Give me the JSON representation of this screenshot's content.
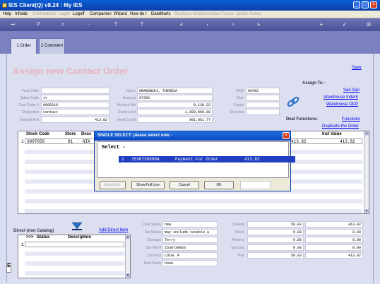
{
  "window": {
    "title": "IES Client(Q) v8.24 : My IES"
  },
  "menu": {
    "items": [
      {
        "label": "Help",
        "enabled": true
      },
      {
        "label": "Infolab",
        "enabled": true
      },
      {
        "label": "Connections",
        "enabled": false
      },
      {
        "label": "Logon",
        "enabled": false
      },
      {
        "label": "Logoff",
        "enabled": true
      },
      {
        "label": "Companion",
        "enabled": true
      },
      {
        "label": "Wizard",
        "enabled": true
      },
      {
        "label": "How do I",
        "enabled": true
      },
      {
        "label": "DataMarts",
        "enabled": true
      },
      {
        "label": "Business Modules",
        "enabled": false
      },
      {
        "label": "Action Focus",
        "enabled": false
      },
      {
        "label": "Option Select",
        "enabled": false
      }
    ]
  },
  "tabs": [
    {
      "label": "1 Order",
      "active": true
    },
    {
      "label": "2 Comment",
      "active": false
    }
  ],
  "page": {
    "title": "Assign new Contact Order",
    "save_link": "Save",
    "assign_to": "Assign To: -",
    "assign_links": [
      "Sari Sari",
      "Warehouse Indent",
      "Warehouse ODP"
    ],
    "deal_functions": "Deal Functions:",
    "functions_link": "Functions",
    "duplicate_link": "Duplicate the Order"
  },
  "form_left": [
    {
      "label": "First Order",
      "value": ""
    },
    {
      "label": "Sales Code",
      "value": "tt"
    },
    {
      "label": "Cust Order #",
      "value": "0000216"
    },
    {
      "label": "Origination",
      "value": "contact"
    },
    {
      "label": "Deposit Amt",
      "value": "413.82"
    }
  ],
  "form_mid": [
    {
      "label": "Name",
      "value": "GRABOWSKI, THERESA"
    },
    {
      "label": "Account",
      "value": "07306"
    },
    {
      "label": "Account Bal",
      "value": "8,138.23"
    },
    {
      "label": "Credit Limit",
      "value": "1,000,000.00"
    },
    {
      "label": "Avail Credit",
      "value": "991,861.77"
    }
  ],
  "form_right": [
    {
      "label": "CRM",
      "value": "00492"
    },
    {
      "label": "Club",
      "value": ""
    },
    {
      "label": "Expiry",
      "value": ""
    },
    {
      "label": "Directive",
      "value": ""
    }
  ],
  "order_grid": {
    "headers": [
      "Stock Code",
      "Store",
      "Desc",
      "Incl Value"
    ],
    "rows": [
      {
        "no": "1",
        "stock": "3007058",
        "store": "01",
        "desc": "NIK",
        "value2": "413.82",
        "incl": "413.82"
      }
    ]
  },
  "modal": {
    "title": "SINGLE SELECT: please select now -",
    "select_label": "Select -",
    "items": [
      {
        "no": "1",
        "code": "1536739896A",
        "desc": "Payment For Order",
        "amount": "413.82"
      }
    ],
    "buttons": {
      "select_all": "Select ALL",
      "show_full": "Show Full Line",
      "cancel": "Cancel",
      "ok": "OK"
    },
    "input_value": ""
  },
  "direct": {
    "title": "Direct (non Catalog)",
    "add_link": "Add Direct Item",
    "headers": [
      ">>>",
      "Status",
      "Description"
    ],
    "row_no": "1"
  },
  "deal_info": [
    {
      "label": "Deal Status",
      "value": "new"
    },
    {
      "label": "Tax Status",
      "value": "may include taxable a"
    },
    {
      "label": "Operator",
      "value": "Terry"
    },
    {
      "label": "Sys Ref #",
      "value": "1536739863"
    },
    {
      "label": "Currency",
      "value": "LOCAL R"
    },
    {
      "label": "Rate Basis",
      "value": "none"
    }
  ],
  "totals": [
    {
      "label": "Catalog",
      "value1": "58.83",
      "value2": "413.82"
    },
    {
      "label": "Direct",
      "value1": "0.00",
      "value2": "0.00"
    },
    {
      "label": "Returns",
      "value1": "0.00",
      "value2": "0.00"
    },
    {
      "label": "Specials",
      "value1": "0.00",
      "value2": "0.00"
    },
    {
      "label": "Nett",
      "value1": "58.83",
      "value2": "413.82"
    }
  ]
}
